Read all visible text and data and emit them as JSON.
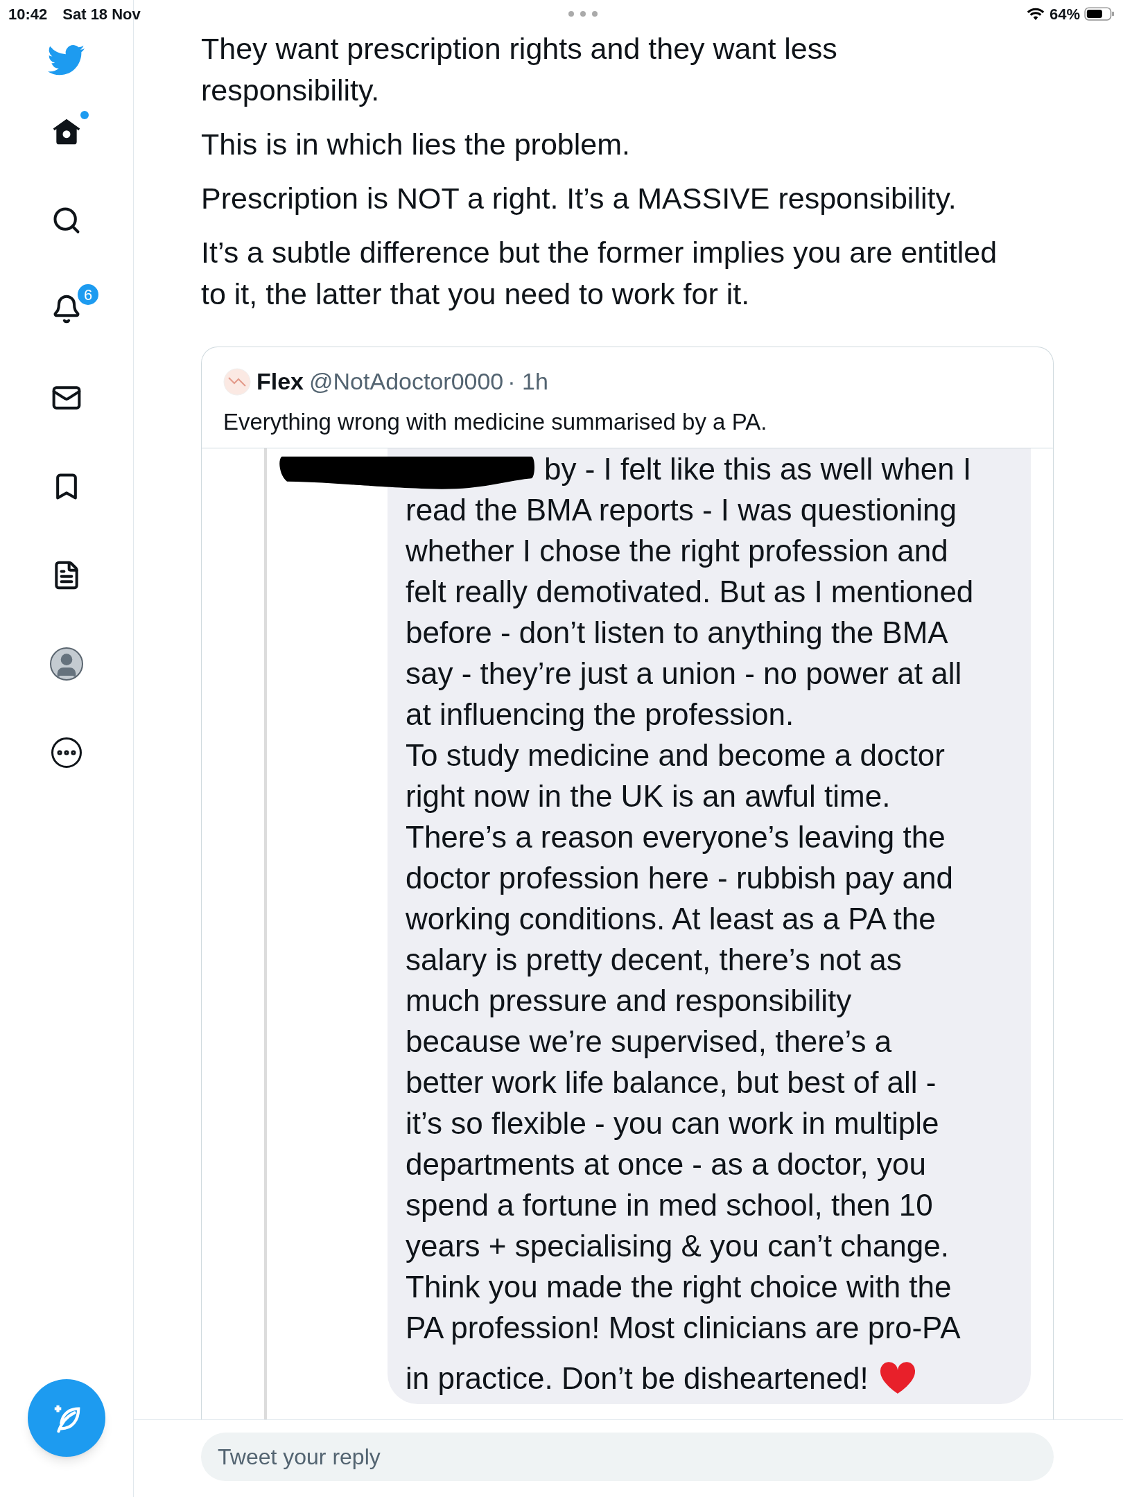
{
  "status_bar": {
    "time": "10:42",
    "date": "Sat 18 Nov",
    "battery": "64%"
  },
  "sidebar": {
    "items": [
      {
        "kind": "home",
        "dot": true
      },
      {
        "kind": "search",
        "dot": false
      },
      {
        "kind": "notifications",
        "dot": false,
        "badge": "6"
      },
      {
        "kind": "messages",
        "dot": false
      },
      {
        "kind": "bookmarks",
        "dot": false
      },
      {
        "kind": "lists",
        "dot": false
      },
      {
        "kind": "profile",
        "dot": false
      },
      {
        "kind": "more",
        "dot": false
      }
    ]
  },
  "tweet": {
    "paragraphs": [
      "They want prescription rights and they want less responsibility.",
      "This is in which lies the problem.",
      "Prescription is NOT a right. It’s a MASSIVE responsibility.",
      "It’s a subtle difference but the former implies you are entitled to it, the latter that you need to work for it."
    ]
  },
  "quote": {
    "name": "Flex",
    "handle": "@NotAdoctor0000",
    "time": "· 1h",
    "text": "Everything wrong with medicine summarised by a PA.",
    "image_lines": [
      "by - I felt like this as well when I",
      "read the BMA reports - I was questioning",
      "whether I chose the right profession and",
      "felt really demotivated. But as I mentioned",
      "before - don’t listen to anything the BMA",
      "say - they’re just a union - no power at all",
      "at influencing the profession.",
      "To study medicine and become a doctor",
      "right now in the UK is an awful time.",
      "There’s a reason everyone’s leaving the",
      "doctor profession here - rubbish pay and",
      "working conditions. At least as a PA the",
      "salary is pretty decent, there’s not as",
      "much pressure and responsibility",
      "because we’re supervised, there’s a",
      "better work life balance, but best of all -",
      "it’s so flexible - you can work in multiple",
      "departments at once - as a doctor, you",
      "spend a fortune in med school, then 10",
      "years + specialising & you can’t change.",
      "Think you made the right choice with the",
      "PA profession! Most clinicians are pro-PA",
      "in practice. Don’t be disheartened!"
    ]
  },
  "reply": {
    "placeholder": "Tweet your reply"
  }
}
